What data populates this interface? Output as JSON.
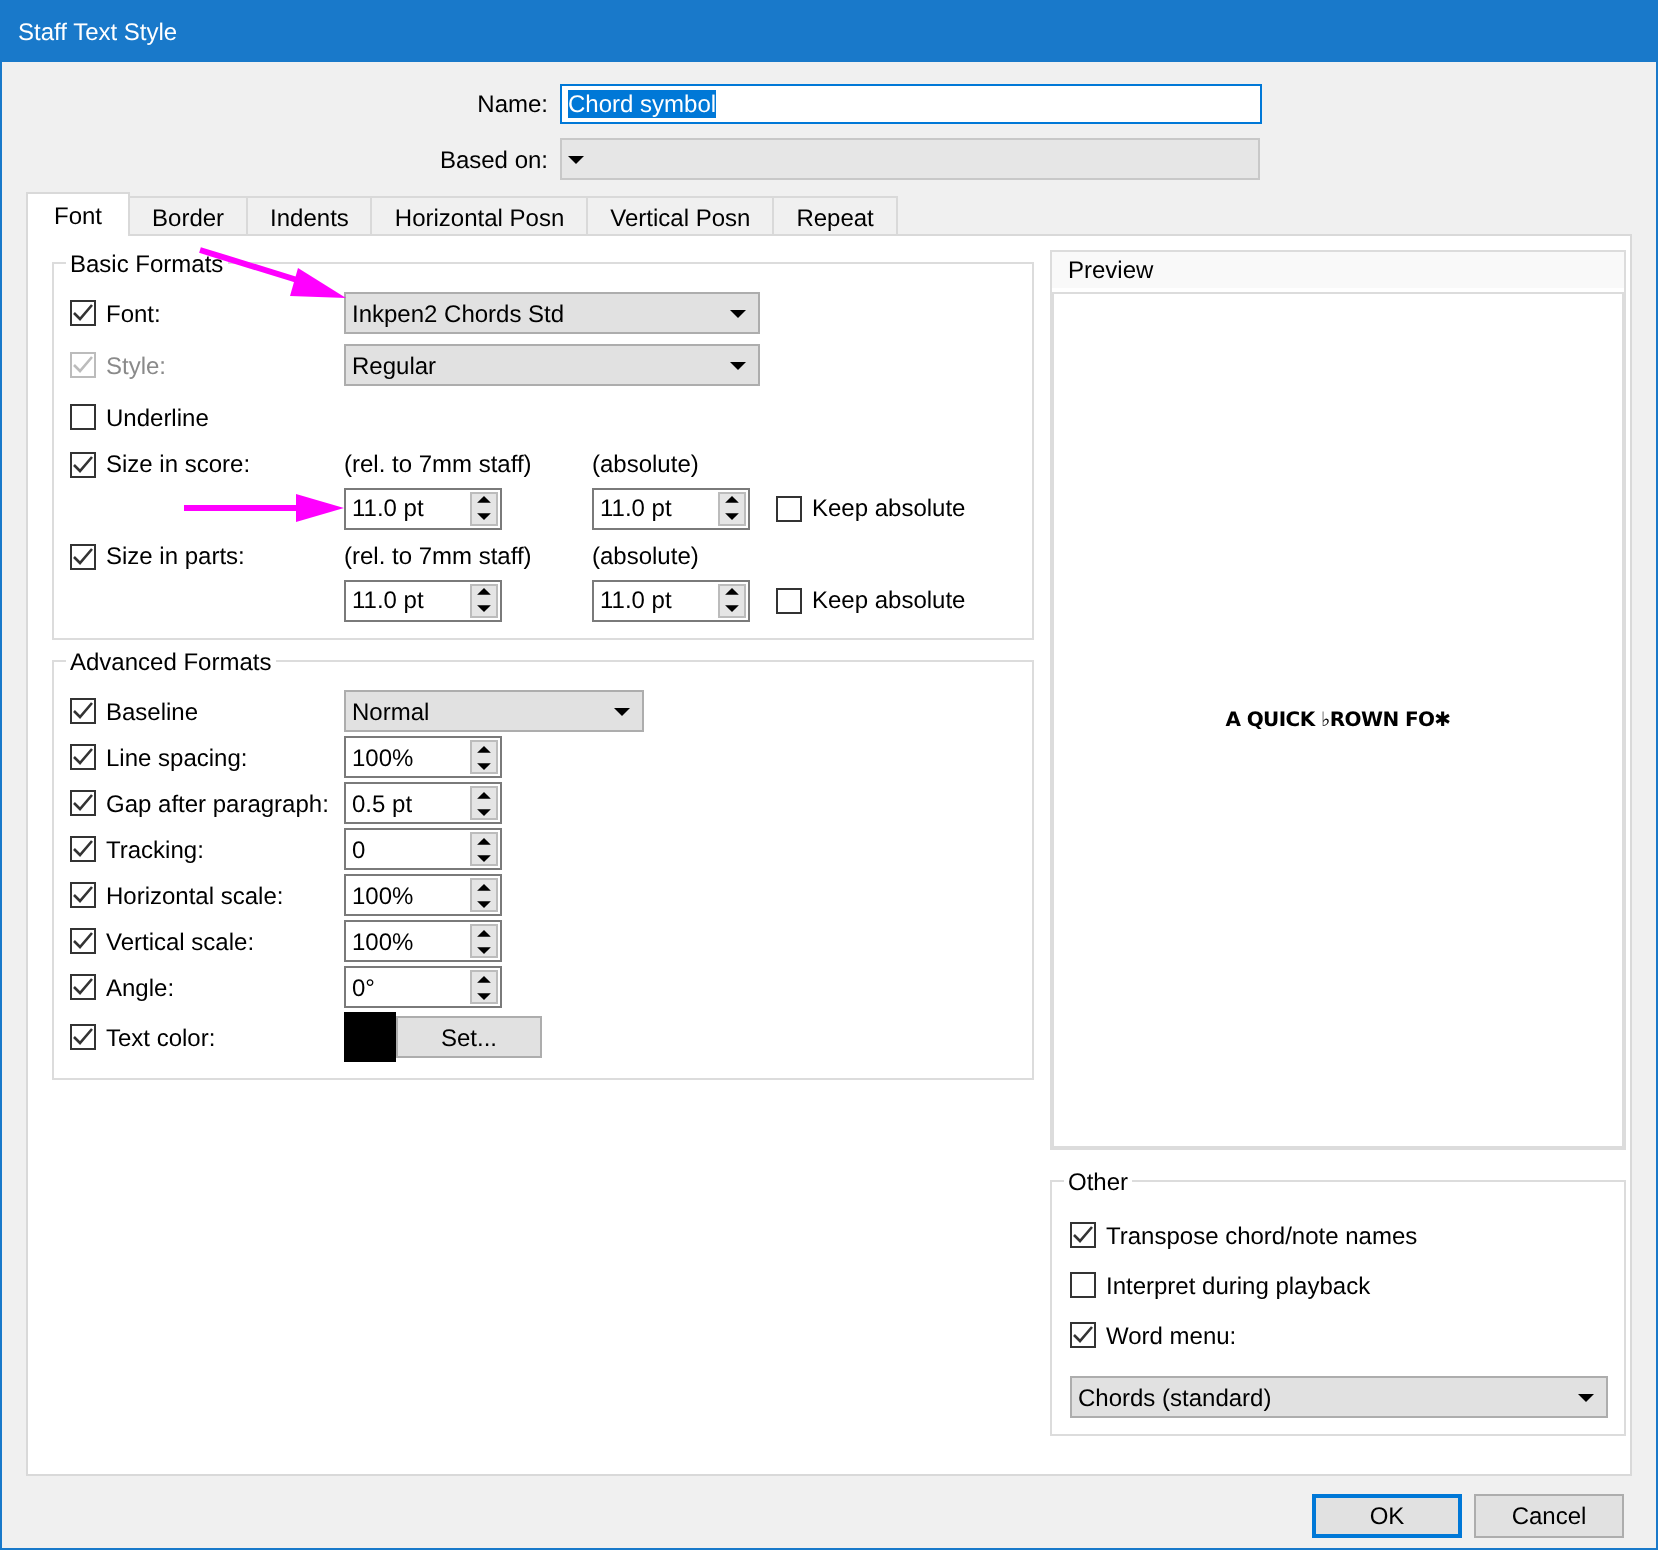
{
  "window": {
    "title": "Staff Text Style"
  },
  "name": {
    "label": "Name:",
    "value": "Chord symbol",
    "text_selected": true
  },
  "based_on": {
    "label": "Based on:",
    "disabled": true
  },
  "tabs": [
    {
      "label": "Font",
      "selected": true
    },
    {
      "label": "Border",
      "selected": false
    },
    {
      "label": "Indents",
      "selected": false
    },
    {
      "label": "Horizontal Posn",
      "selected": false
    },
    {
      "label": "Vertical Posn",
      "selected": false
    },
    {
      "label": "Repeat",
      "selected": false
    }
  ],
  "basic_formats": {
    "title": "Basic Formats",
    "rows": [
      {
        "kind": "dropdown",
        "label": "Font:",
        "checked": true,
        "disabled": false,
        "value": "Inkpen2 Chords Std",
        "arrow_pointing": true
      },
      {
        "kind": "dropdown",
        "label": "Style:",
        "checked": true,
        "disabled": true,
        "value": "Regular",
        "arrow_pointing": false
      },
      {
        "kind": "plain",
        "label": "Underline",
        "checked": false,
        "disabled": false
      },
      {
        "kind": "size",
        "label": "Size in score:",
        "checked": true,
        "relative_caption": "(rel. to 7mm staff)",
        "absolute_caption": "(absolute)",
        "relative_value": "11.0 pt",
        "absolute_value": "11.0 pt",
        "keep_label": "Keep absolute",
        "keep_checked": false,
        "arrow_pointing": true
      },
      {
        "kind": "size",
        "label": "Size in parts:",
        "checked": true,
        "relative_caption": "(rel. to 7mm staff)",
        "absolute_caption": "(absolute)",
        "relative_value": "11.0 pt",
        "absolute_value": "11.0 pt",
        "keep_label": "Keep absolute",
        "keep_checked": false,
        "arrow_pointing": false
      }
    ]
  },
  "advanced_formats": {
    "title": "Advanced Formats",
    "rows": [
      {
        "kind": "dropdown",
        "label": "Baseline",
        "checked": true,
        "value": "Normal"
      },
      {
        "kind": "spin",
        "label": "Line spacing:",
        "checked": true,
        "value": "100%"
      },
      {
        "kind": "spin",
        "label": "Gap after paragraph:",
        "checked": true,
        "value": "0.5 pt"
      },
      {
        "kind": "spin",
        "label": "Tracking:",
        "checked": true,
        "value": "0"
      },
      {
        "kind": "spin",
        "label": "Horizontal scale:",
        "checked": true,
        "value": "100%"
      },
      {
        "kind": "spin",
        "label": "Vertical scale:",
        "checked": true,
        "value": "100%"
      },
      {
        "kind": "spin",
        "label": "Angle:",
        "checked": true,
        "value": "0°"
      },
      {
        "kind": "color",
        "label": "Text color:",
        "checked": true,
        "color": "#000000",
        "button": "Set..."
      }
    ]
  },
  "preview": {
    "title": "Preview",
    "sample": "A QUICK ♭ROWN FO✱"
  },
  "other": {
    "title": "Other",
    "options": [
      {
        "label": "Transpose chord/note names",
        "checked": true
      },
      {
        "label": "Interpret during playback",
        "checked": false
      },
      {
        "label": "Word menu:",
        "checked": true
      }
    ],
    "word_menu": "Chords (standard)"
  },
  "buttons": [
    {
      "label": "OK",
      "default": true
    },
    {
      "label": "Cancel",
      "default": false
    }
  ]
}
